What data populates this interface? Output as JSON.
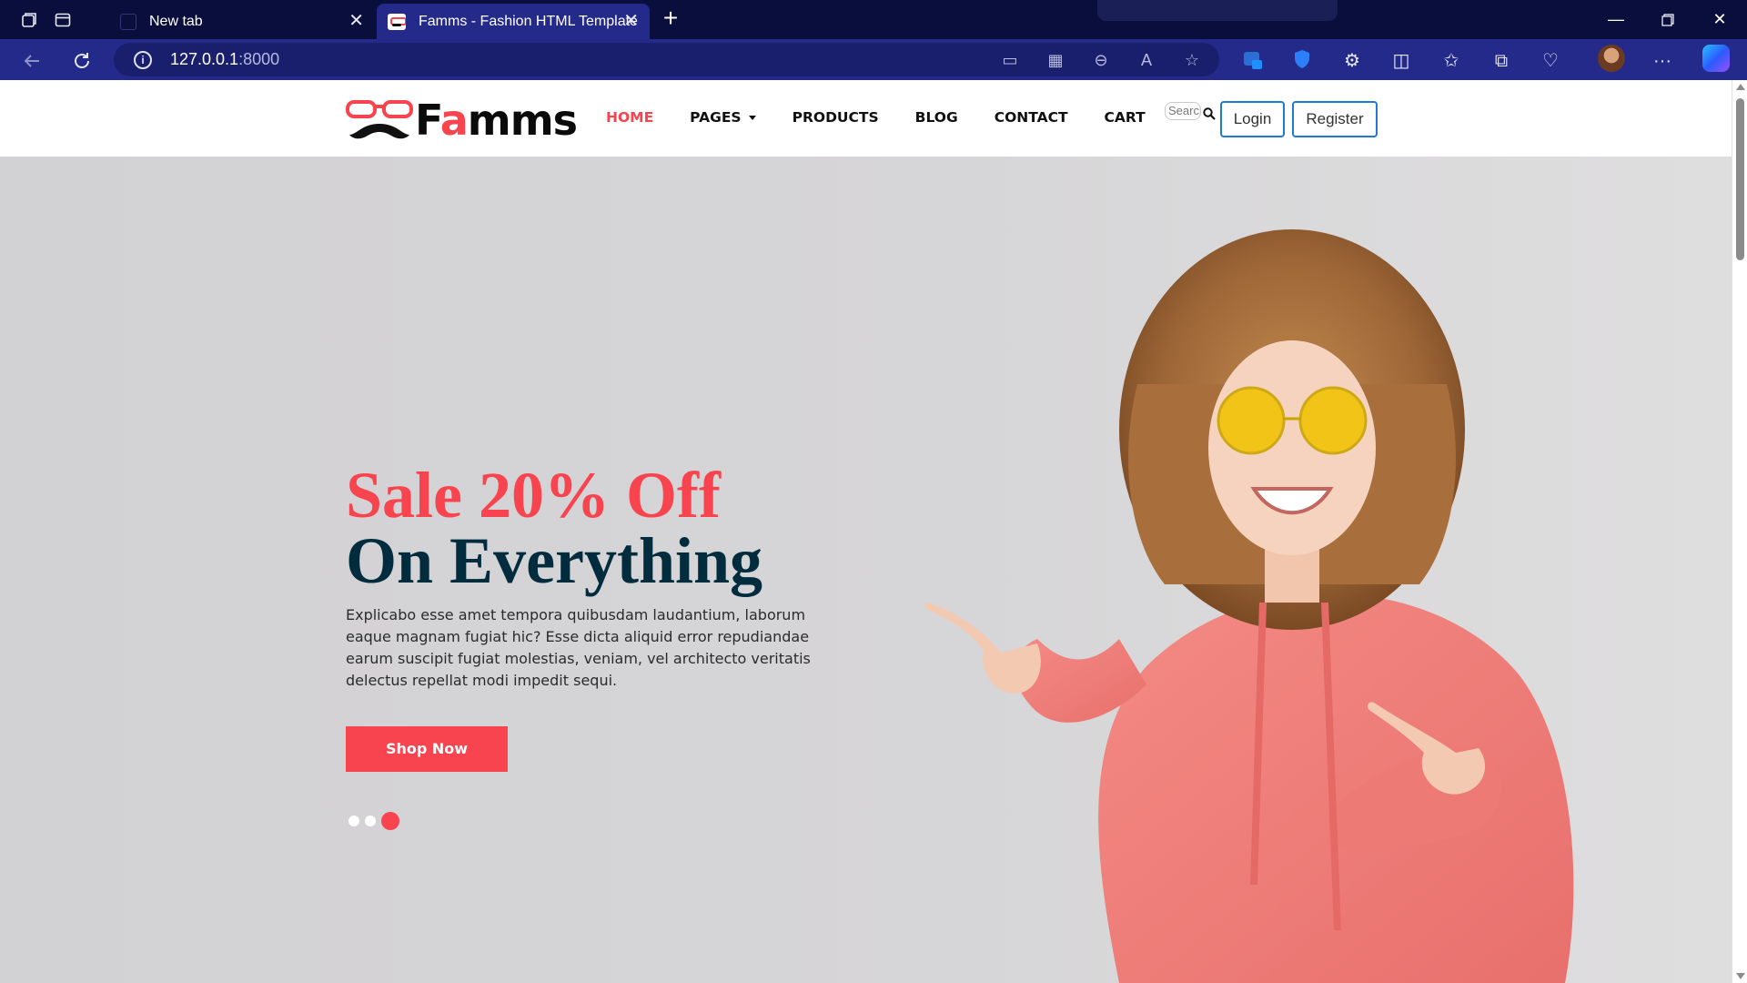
{
  "browser": {
    "tabs": [
      {
        "title": "New tab",
        "active": false
      },
      {
        "title": "Famms - Fashion HTML Template",
        "active": true
      }
    ],
    "url_host": "127.0.0.1",
    "url_port": ":8000",
    "icons": {
      "workspaces": "workspaces-icon",
      "tab_actions": "tab-actions-icon",
      "back": "back-icon",
      "refresh": "refresh-icon",
      "info": "i"
    }
  },
  "site": {
    "logo_prefix": "F",
    "logo_accent": "a",
    "logo_suffix": "mms",
    "nav": [
      {
        "label": "HOME",
        "active": true
      },
      {
        "label": "PAGES",
        "dropdown": true
      },
      {
        "label": "PRODUCTS"
      },
      {
        "label": "BLOG"
      },
      {
        "label": "CONTACT"
      },
      {
        "label": "CART"
      }
    ],
    "search_placeholder": "Search",
    "login_label": "Login",
    "register_label": "Register"
  },
  "hero": {
    "title_line1": "Sale 20% Off",
    "title_line2": "On Everything",
    "description": "Explicabo esse amet tempora quibusdam laudantium, laborum eaque magnam fugiat hic? Esse dicta aliquid error repudiandae earum suscipit fugiat molestias, veniam, vel architecto veritatis delectus repellat modi impedit sequi.",
    "cta_label": "Shop Now",
    "slides_total": 3,
    "slide_active": 3
  },
  "colors": {
    "accent": "#f7444e",
    "heading_dark": "#002c3e",
    "browser_dark": "#0a0e3d",
    "browser_bar": "#232a8a",
    "button_border": "#1f7ad4"
  }
}
